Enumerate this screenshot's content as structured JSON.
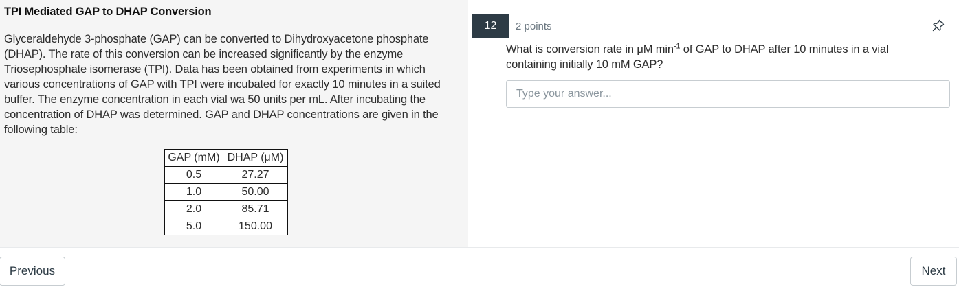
{
  "stimulus": {
    "title": "TPI Mediated GAP to DHAP Conversion",
    "body": "Glyceraldehyde 3-phosphate (GAP) can be converted to Dihydroxyacetone phosphate (DHAP). The rate of this conversion can be increased significantly by the enzyme Triosephosphate isomerase (TPI). Data has been obtained from experiments in which various concentrations of GAP with TPI were incubated for exactly 10 minutes in a suited buffer. The enzyme concentration in each vial wa 50 units per mL. After incubating the concentration of DHAP was determined. GAP and DHAP concentrations are given in the following table:",
    "table": {
      "headers": [
        "GAP (mM)",
        "DHAP (μM)"
      ],
      "rows": [
        [
          "0.5",
          "27.27"
        ],
        [
          "1.0",
          "50.00"
        ],
        [
          "2.0",
          "85.71"
        ],
        [
          "5.0",
          "150.00"
        ]
      ]
    }
  },
  "question": {
    "number": "12",
    "points": "2 points",
    "text_before_sup": "What is conversion rate in μM min",
    "text_sup": "-1",
    "text_after_sup": " of GAP to DHAP after 10 minutes in a vial containing initially 10 mM GAP?",
    "answer_value": "",
    "answer_placeholder": "Type your answer..."
  },
  "navigation": {
    "previous_label": "Previous",
    "next_label": "Next"
  },
  "icons": {
    "pin": "pin-icon"
  },
  "colors": {
    "question_badge": "#2d3b45",
    "left_panel_bg": "#f5f5f5"
  }
}
